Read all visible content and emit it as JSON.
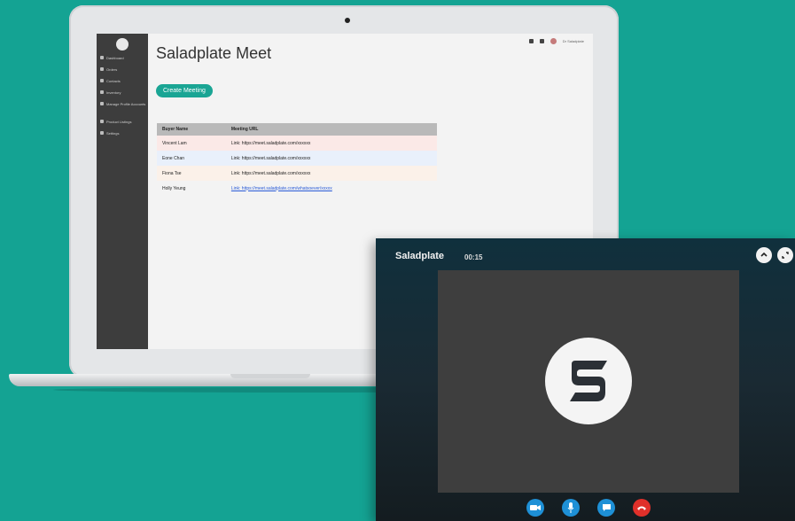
{
  "app": {
    "title": "Saladplate Meet",
    "create_button": "Create Meeting",
    "user_label": "Dr Saladplate"
  },
  "sidebar": {
    "items": [
      {
        "label": "Dashboard"
      },
      {
        "label": "Orders"
      },
      {
        "label": "Contacts"
      },
      {
        "label": "Inventory"
      },
      {
        "label": "Manage Profile Accounts"
      },
      {
        "label": "Product Listings"
      },
      {
        "label": "Settings"
      }
    ]
  },
  "table": {
    "headers": [
      "Buyer Name",
      "Meeting URL"
    ],
    "rows": [
      {
        "name": "Vincent Lam",
        "url": "Link: https://meet.saladplate.com/xxxxxx"
      },
      {
        "name": "Eone Chan",
        "url": "Link: https://meet.saladplate.com/xxxxxx"
      },
      {
        "name": "Fiona Tse",
        "url": "Link: https://meet.saladplate.com/xxxxxx"
      },
      {
        "name": "Holly Yeung",
        "url": "Link: https://meet.saladplate.com/whatsoever/xxxxx"
      }
    ]
  },
  "call": {
    "title": "Saladplate",
    "timer": "00:15"
  },
  "colors": {
    "background": "#14a393",
    "accent": "#1aa594",
    "control_blue": "#1e90d6",
    "hangup_red": "#e0302a"
  }
}
